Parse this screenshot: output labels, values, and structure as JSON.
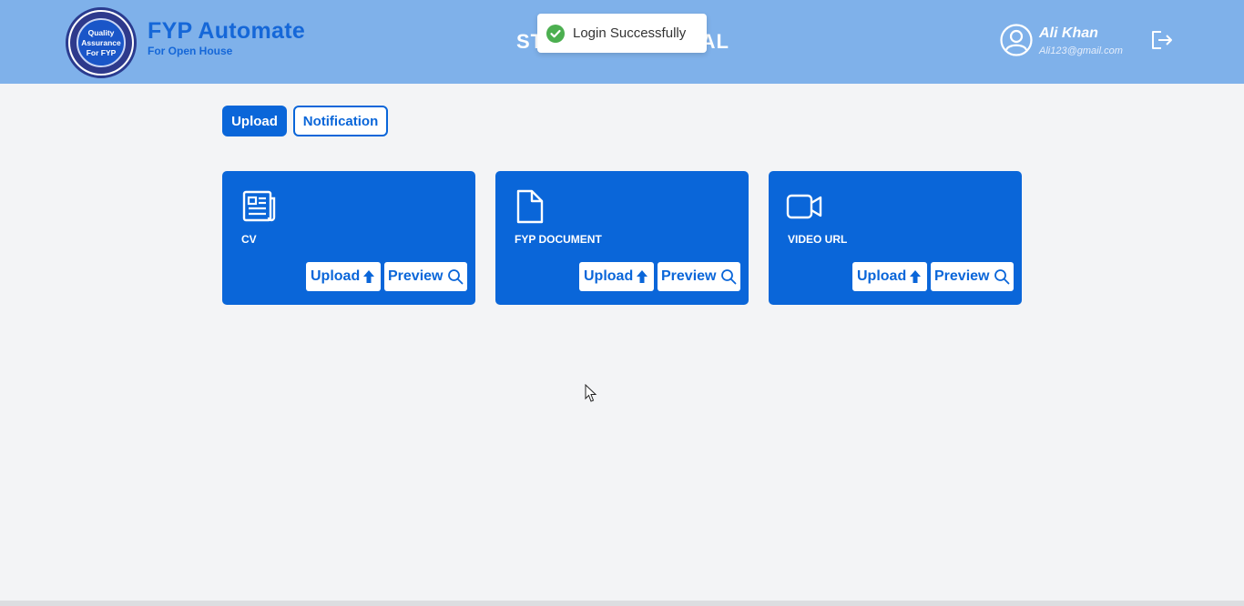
{
  "header": {
    "logo": {
      "ring_text": "COMSATS UNIVERSITY",
      "line1": "Quality",
      "line2": "Assurance",
      "line3": "For FYP",
      "bottom_text": "ISLAMABAD"
    },
    "brand_title": "FYP Automate",
    "brand_subtitle": "For Open House",
    "portal_title_left": "ST",
    "portal_title_right": "AL",
    "user": {
      "name": "Ali Khan",
      "email": "Ali123@gmail.com",
      "avatar_icon": "user-circle-icon"
    },
    "logout_icon": "logout-icon",
    "bg_color": "#7fb1ea"
  },
  "toast": {
    "message": "Login Successfully",
    "icon": "check-circle-icon",
    "icon_color": "#4caf50"
  },
  "tabs": [
    {
      "label": "Upload",
      "active": true
    },
    {
      "label": "Notification",
      "active": false
    }
  ],
  "cards": [
    {
      "title": "CV",
      "icon": "newspaper-icon",
      "upload_label": "Upload",
      "preview_label": "Preview"
    },
    {
      "title": "FYP DOCUMENT",
      "icon": "document-icon",
      "upload_label": "Upload",
      "preview_label": "Preview"
    },
    {
      "title": "VIDEO URL",
      "icon": "video-camera-icon",
      "upload_label": "Upload",
      "preview_label": "Preview"
    }
  ],
  "colors": {
    "primary": "#0a66d9",
    "background": "#f3f4f6"
  }
}
